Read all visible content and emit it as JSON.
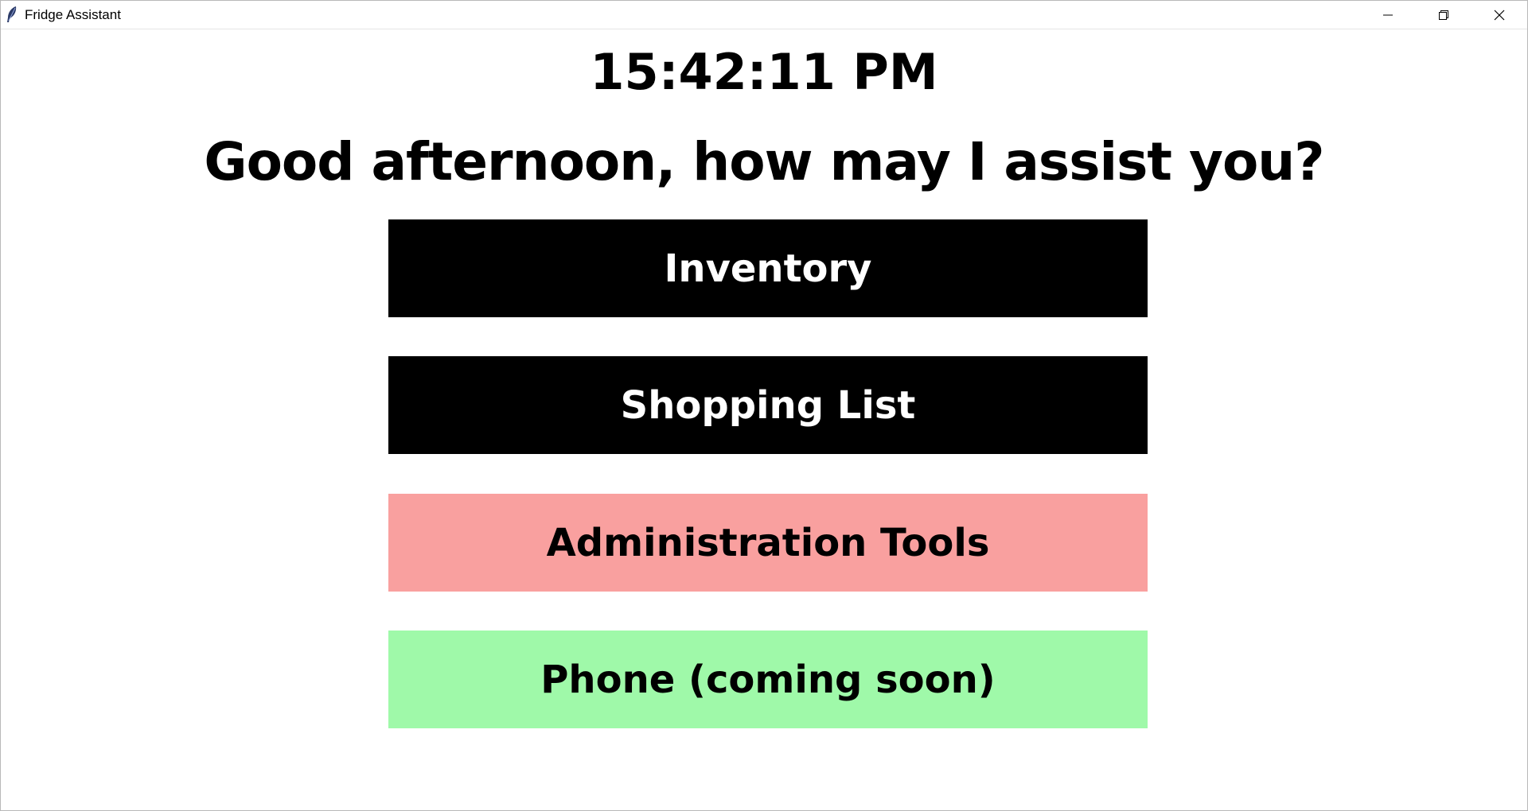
{
  "window": {
    "title": "Fridge Assistant",
    "app_icon": "feather-icon",
    "controls": [
      "minimize-icon",
      "restore-icon",
      "close-icon"
    ]
  },
  "clock": {
    "time": "15:42:11 PM"
  },
  "greeting": {
    "text": "Good afternoon, how may I assist you?"
  },
  "menu": {
    "inventory_label": "Inventory",
    "shopping_label": "Shopping List",
    "admin_label": "Administration Tools",
    "phone_label": "Phone (coming soon)"
  },
  "colors": {
    "inventory_bg": "#000000",
    "shopping_bg": "#000000",
    "admin_bg": "#f9a09f",
    "phone_bg": "#9ff9a9"
  }
}
